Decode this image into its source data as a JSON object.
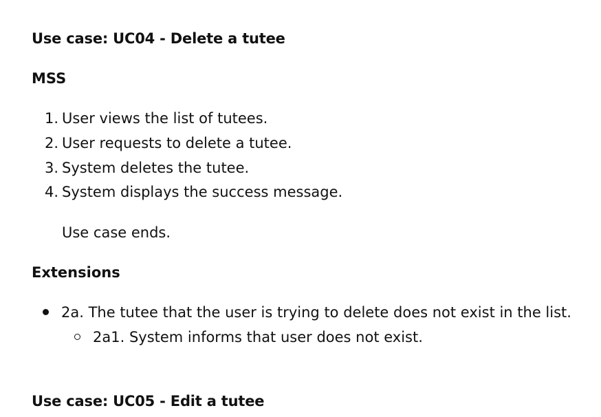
{
  "uc04": {
    "title": "Use case: UC04 - Delete a tutee",
    "mss_heading": "MSS",
    "steps": [
      {
        "num": "1.",
        "text": "User views the list of tutees."
      },
      {
        "num": "2.",
        "text": "User requests to delete a tutee."
      },
      {
        "num": "3.",
        "text": "System deletes the tutee."
      },
      {
        "num": "4.",
        "text": "System displays the success message."
      }
    ],
    "ends": "Use case ends.",
    "extensions_heading": "Extensions",
    "extensions": [
      {
        "text": "2a. The tutee that the user is trying to delete does not exist in the list.",
        "sub": [
          "2a1. System informs that user does not exist."
        ]
      }
    ]
  },
  "uc05": {
    "title": "Use case: UC05 - Edit a tutee"
  }
}
